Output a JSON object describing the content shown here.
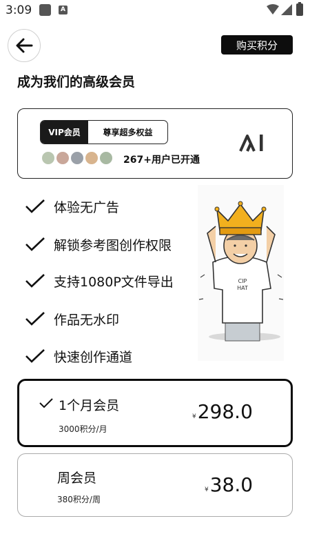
{
  "status_bar": {
    "time": "3:09",
    "app_icon_letter": "A"
  },
  "header": {
    "buy_points_label": "购买积分"
  },
  "page_title": "成为我们的高级会员",
  "vip_card": {
    "badge_left": "VIP会员",
    "badge_right": "尊享超多权益",
    "users_text": "267+用户已开通",
    "logo_text": "AI",
    "avatar_colors": [
      "#b9c6b0",
      "#c9a79a",
      "#9aa0a8",
      "#d8b48e",
      "#a8b9a2"
    ]
  },
  "benefits": [
    "体验无广告",
    "解锁参考图创作权限",
    "支持1080P文件导出",
    "作品无水印",
    "快速创作通道"
  ],
  "illustration": {
    "shirt_text_line1": "CIP",
    "shirt_text_line2": "HAT"
  },
  "plans": [
    {
      "name": "1个月会员",
      "sub": "3000积分/月",
      "currency": "¥",
      "price": "298.0",
      "selected": true
    },
    {
      "name": "周会员",
      "sub": "380积分/周",
      "currency": "¥",
      "price": "38.0",
      "selected": false
    }
  ],
  "colors": {
    "primary": "#0d0d0d",
    "background": "#ffffff",
    "crown": "#f2b01e"
  }
}
